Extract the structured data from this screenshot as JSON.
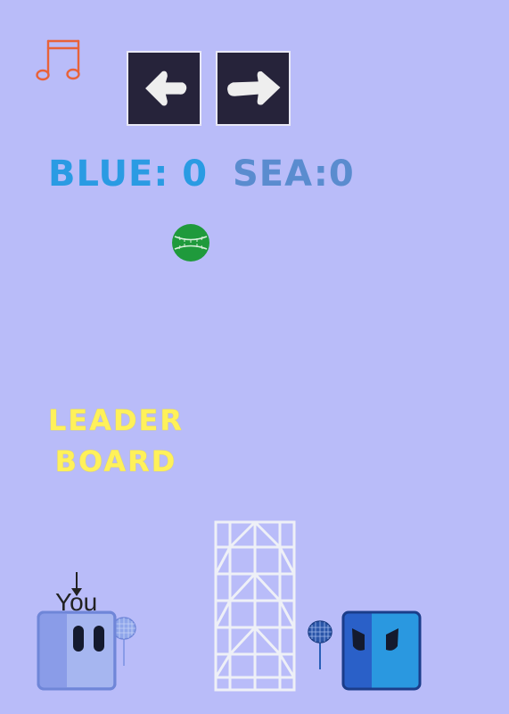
{
  "controls": {
    "music_icon": "music-note-icon",
    "left_icon": "arrow-left-icon",
    "right_icon": "arrow-right-icon"
  },
  "score": {
    "blue": "BLUE: 0",
    "sea": "SEA:0"
  },
  "leaderboard": {
    "line1": "LEADER",
    "line2": "BOARD"
  },
  "player": {
    "you_label": "You"
  },
  "colors": {
    "background": "#b9bcf9",
    "score_blue": "#2a9be3",
    "score_sea": "#5a8ccf",
    "leaderboard": "#fff15a",
    "ball": "#1f9a3c",
    "player": "#8a9ce8",
    "enemy": "#2a98e0",
    "music_icon": "#e8623a"
  }
}
